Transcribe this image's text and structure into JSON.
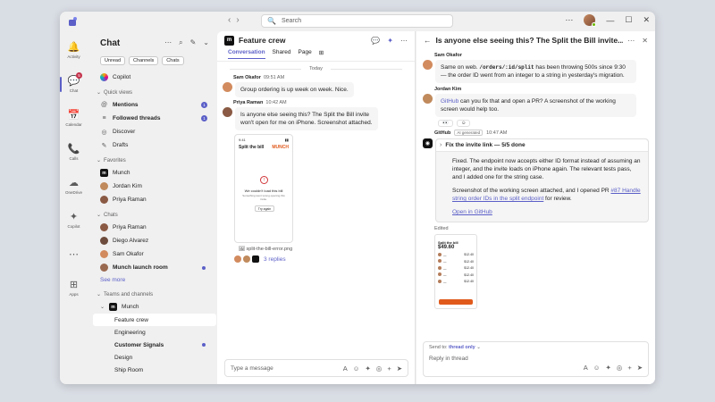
{
  "search": {
    "placeholder": "Search"
  },
  "rail": [
    {
      "icon": "bell-icon",
      "glyph": "🔔",
      "label": "Activity"
    },
    {
      "icon": "chat-icon",
      "glyph": "💬",
      "label": "Chat",
      "badge": "5",
      "active": true
    },
    {
      "icon": "calendar-icon",
      "glyph": "📅",
      "label": "Calendar"
    },
    {
      "icon": "phone-icon",
      "glyph": "📞",
      "label": "Calls"
    },
    {
      "icon": "cloud-icon",
      "glyph": "☁",
      "label": "OneDrive"
    },
    {
      "icon": "copilot-icon",
      "glyph": "✦",
      "label": "Copilot"
    },
    {
      "icon": "more-icon",
      "glyph": "⋯",
      "label": ""
    },
    {
      "icon": "apps-icon",
      "glyph": "⊞",
      "label": "Apps"
    }
  ],
  "sidebar": {
    "title": "Chat",
    "filters": [
      "Unread",
      "Channels",
      "Chats"
    ],
    "copilot": "Copilot",
    "quick_views_label": "Quick views",
    "quick_views": [
      {
        "label": "Mentions",
        "icon": "at-icon",
        "glyph": "@",
        "bold": true,
        "count": "1"
      },
      {
        "label": "Followed threads",
        "icon": "threads-icon",
        "glyph": "≡",
        "bold": true,
        "count": "1"
      },
      {
        "label": "Discover",
        "icon": "compass-icon",
        "glyph": "◎",
        "bold": false
      },
      {
        "label": "Drafts",
        "icon": "pencil-icon",
        "glyph": "✎",
        "bold": false
      }
    ],
    "favorites_label": "Favorites",
    "favorites": [
      "Munch",
      "Jordan Kim",
      "Priya Raman"
    ],
    "chats_label": "Chats",
    "chats": [
      {
        "label": "Priya Raman",
        "bold": false
      },
      {
        "label": "Diego Alvarez",
        "bold": false
      },
      {
        "label": "Sam Okafor",
        "bold": false
      },
      {
        "label": "Munch launch room",
        "bold": true
      }
    ],
    "see_more": "See more",
    "teams_label": "Teams and channels",
    "team": "Munch",
    "channels": [
      {
        "label": "Feature crew",
        "active": true,
        "bold": false
      },
      {
        "label": "Engineering",
        "active": false,
        "bold": false
      },
      {
        "label": "Customer Signals",
        "active": false,
        "bold": true
      },
      {
        "label": "Design",
        "active": false,
        "bold": false
      },
      {
        "label": "Ship Room",
        "active": false,
        "bold": false
      }
    ]
  },
  "channel": {
    "title": "Feature crew",
    "tabs": [
      "Conversation",
      "Shared",
      "Page"
    ],
    "day": "Today",
    "msg1": {
      "author": "Sam Okafor",
      "time": "09:51 AM",
      "text": "Group ordering is up week on week. Nice."
    },
    "msg2": {
      "author": "Priya Raman",
      "time": "10:42 AM",
      "text": "Is anyone else seeing this? The Split the Bill invite won't open for me on iPhone. Screenshot attached."
    },
    "screenshot": {
      "time": "9:41",
      "title": "Split the bill",
      "brand": "MUNCH",
      "error": "We couldn't load this bill",
      "sub": "Something went wrong opening this invite.",
      "retry": "Try again"
    },
    "file": "split-the-bill-error.png",
    "replies": "3 replies",
    "composer_placeholder": "Type a message"
  },
  "thread": {
    "title": "Is anyone else seeing this? The Split the Bill invite...",
    "m1": {
      "author": "Sam Okafor",
      "pre": "Same on web. ",
      "code": "/orders/:id/split",
      "post": " has been throwing 500s since 9:30 — the order ID went from an integer to a string in yesterday's migration."
    },
    "m2": {
      "author": "Jordan Kim",
      "mention": "GitHub",
      "text": " can you fix that and open a PR? A screenshot of the working screen would help too."
    },
    "reactions": [
      "👀",
      "👍"
    ],
    "gh": {
      "author": "GitHub",
      "badge": "AI generated",
      "time": "10:47 AM",
      "card_title": "Fix the invite link — 5/5 done",
      "p1": "Fixed. The endpoint now accepts either ID format instead of assuming an integer, and the invite loads on iPhone again. The relevant tests pass, and I added one for the string case.",
      "p2_pre": "Screenshot of the working screen attached, and I opened PR ",
      "p2_link": "#87 Handle string order IDs in the split endpoint",
      "p2_post": " for review.",
      "open_link": "Open in GitHub"
    },
    "edited": "Edited",
    "receipt": {
      "title": "Split the bill",
      "amount": "$49.60",
      "rows": [
        "$12.40",
        "$12.40",
        "$12.40",
        "$12.40",
        "$12.40"
      ]
    },
    "send_to": "Send to:",
    "send_target": "thread only",
    "reply_placeholder": "Reply in thread"
  }
}
